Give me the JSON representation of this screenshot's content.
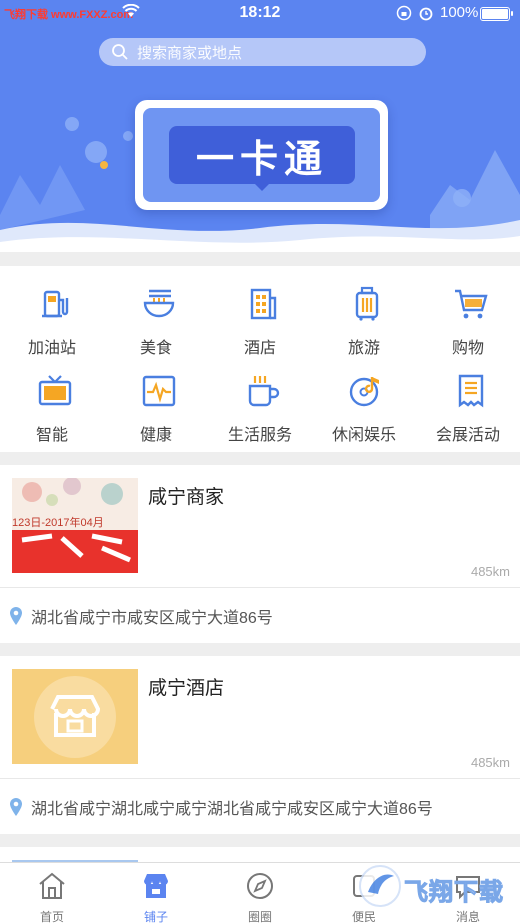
{
  "status_bar": {
    "watermark": "飞翔下载 www.FXXZ.com",
    "time": "18:12",
    "battery": "100%"
  },
  "search": {
    "placeholder": "搜索商家或地点"
  },
  "banner": {
    "title": "一卡通"
  },
  "categories": [
    {
      "label": "加油站",
      "icon": "gas-station-icon"
    },
    {
      "label": "美食",
      "icon": "noodle-bowl-icon"
    },
    {
      "label": "酒店",
      "icon": "hotel-building-icon"
    },
    {
      "label": "旅游",
      "icon": "luggage-icon"
    },
    {
      "label": "购物",
      "icon": "shopping-cart-icon"
    },
    {
      "label": "智能",
      "icon": "tv-icon"
    },
    {
      "label": "健康",
      "icon": "heartbeat-monitor-icon"
    },
    {
      "label": "生活服务",
      "icon": "coffee-cup-icon"
    },
    {
      "label": "休闲娱乐",
      "icon": "music-disc-icon"
    },
    {
      "label": "会展活动",
      "icon": "receipt-icon"
    }
  ],
  "shops": [
    {
      "name": "咸宁商家",
      "distance": "485km",
      "address": "湖北省咸宁市咸安区咸宁大道86号",
      "thumb_text": "123日-2017年04月"
    },
    {
      "name": "咸宁酒店",
      "distance": "485km",
      "address": "湖北省咸宁湖北咸宁咸宁湖北省咸宁咸安区咸宁大道86号"
    }
  ],
  "tabs": [
    {
      "label": "首页",
      "icon": "home-icon",
      "active": false
    },
    {
      "label": "铺子",
      "icon": "shop-icon",
      "active": true
    },
    {
      "label": "圈圈",
      "icon": "compass-icon",
      "active": false
    },
    {
      "label": "便民",
      "icon": "convenience-icon",
      "active": false
    },
    {
      "label": "消息",
      "icon": "message-icon",
      "active": false
    }
  ],
  "watermark_logo": "飞翔下载",
  "colors": {
    "accent": "#5b84f0",
    "icon_blue": "#4a7fe0",
    "icon_orange": "#f5a623"
  }
}
